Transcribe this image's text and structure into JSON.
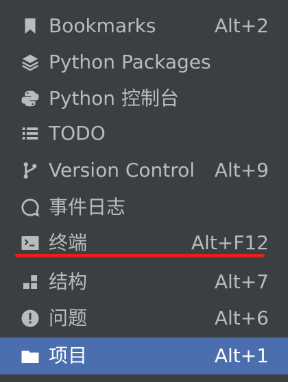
{
  "menu": {
    "items": [
      {
        "label": "Bookmarks",
        "shortcut": "Alt+2",
        "icon": "bookmark-icon"
      },
      {
        "label": "Python Packages",
        "shortcut": "",
        "icon": "layers-icon"
      },
      {
        "label": "Python 控制台",
        "shortcut": "",
        "icon": "python-icon"
      },
      {
        "label": "TODO",
        "shortcut": "",
        "icon": "list-icon"
      },
      {
        "label": "Version Control",
        "shortcut": "Alt+9",
        "icon": "branch-icon"
      },
      {
        "label": "事件日志",
        "shortcut": "",
        "icon": "speech-bubble-icon"
      },
      {
        "label": "终端",
        "shortcut": "Alt+F12",
        "icon": "terminal-icon"
      },
      {
        "label": "结构",
        "shortcut": "Alt+7",
        "icon": "structure-icon"
      },
      {
        "label": "问题",
        "shortcut": "Alt+6",
        "icon": "warning-icon"
      },
      {
        "label": "项目",
        "shortcut": "Alt+1",
        "icon": "folder-icon"
      }
    ],
    "selected_index": 9
  },
  "colors": {
    "background": "#3c3f41",
    "text": "#bbbbbb",
    "selected_background": "#4b6eaf",
    "annotation_underline": "#e8201c"
  }
}
